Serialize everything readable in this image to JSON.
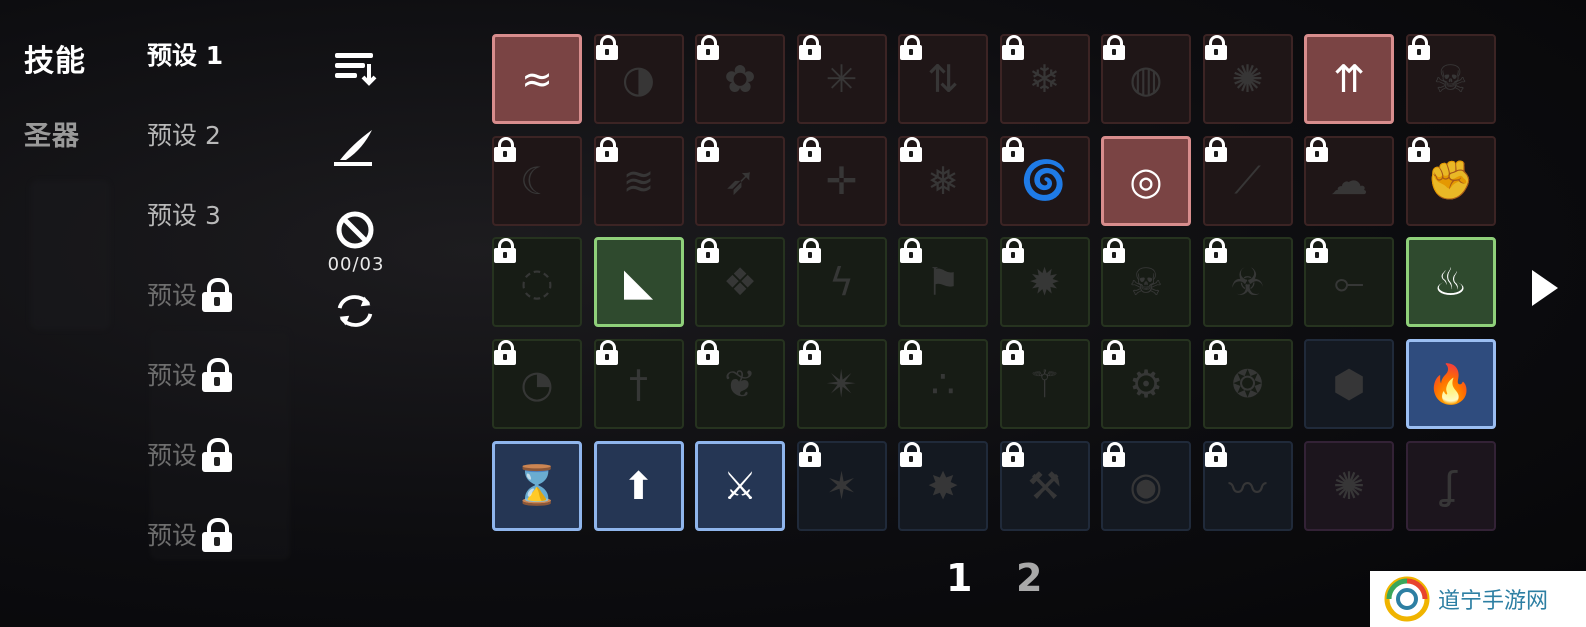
{
  "categories": {
    "skills": "技能",
    "relics": "圣器"
  },
  "presets": [
    {
      "label": "预设 1",
      "state": "active"
    },
    {
      "label": "预设 2",
      "state": "normal"
    },
    {
      "label": "预设 3",
      "state": "normal"
    },
    {
      "label": "预设",
      "state": "locked"
    },
    {
      "label": "预设",
      "state": "locked"
    },
    {
      "label": "预设",
      "state": "locked"
    },
    {
      "label": "预设",
      "state": "locked"
    }
  ],
  "tools": {
    "sort_icon": "sort-icon",
    "edit_icon": "quill-pen-icon",
    "forbid_icon": "no-entry-icon",
    "counter": "00/03",
    "reset_icon": "refresh-icon"
  },
  "grid": {
    "rows": [
      {
        "rarity": "red",
        "cells": [
          {
            "icon": "swoosh-slash-icon",
            "glyph": "≈",
            "state": "equipped",
            "locked": false
          },
          {
            "icon": "blade-circle-icon",
            "glyph": "◑",
            "state": "dim",
            "locked": true
          },
          {
            "icon": "flower-burst-icon",
            "glyph": "✿",
            "state": "dim",
            "locked": true
          },
          {
            "icon": "starburst-icon",
            "glyph": "✳",
            "state": "dim",
            "locked": true
          },
          {
            "icon": "arrows-icon",
            "glyph": "⇅",
            "state": "dim",
            "locked": true
          },
          {
            "icon": "snow-orb-icon",
            "glyph": "❄",
            "state": "dim",
            "locked": true
          },
          {
            "icon": "fire-orb-icon",
            "glyph": "◍",
            "state": "dim",
            "locked": true
          },
          {
            "icon": "dark-storm-icon",
            "glyph": "✺",
            "state": "dim",
            "locked": true
          },
          {
            "icon": "triple-arrows-icon",
            "glyph": "⇈",
            "state": "equipped",
            "locked": false
          },
          {
            "icon": "cow-skull-icon",
            "glyph": "☠",
            "state": "dim",
            "locked": true
          }
        ]
      },
      {
        "rarity": "red",
        "cells": [
          {
            "icon": "crescent-icon",
            "glyph": "☾",
            "state": "dim",
            "locked": true
          },
          {
            "icon": "feathers-icon",
            "glyph": "≋",
            "state": "dim",
            "locked": true
          },
          {
            "icon": "dart-icon",
            "glyph": "➶",
            "state": "dim",
            "locked": true
          },
          {
            "icon": "crosshair-icon",
            "glyph": "✛",
            "state": "dim",
            "locked": true
          },
          {
            "icon": "ice-sword-icon",
            "glyph": "❅",
            "state": "dim",
            "locked": true
          },
          {
            "icon": "vortex-icon",
            "glyph": "🌀",
            "state": "dim",
            "locked": true
          },
          {
            "icon": "target-orb-icon",
            "glyph": "◎",
            "state": "equipped",
            "locked": false
          },
          {
            "icon": "spiky-line-icon",
            "glyph": "⟋",
            "state": "dim",
            "locked": true
          },
          {
            "icon": "cloud-burst-icon",
            "glyph": "☁",
            "state": "dim",
            "locked": true
          },
          {
            "icon": "gauntlet-icon",
            "glyph": "✊",
            "state": "dim",
            "locked": true
          }
        ]
      },
      {
        "rarity": "green",
        "cells": [
          {
            "icon": "black-hole-icon",
            "glyph": "◌",
            "state": "dim",
            "locked": true
          },
          {
            "icon": "impact-spike-icon",
            "glyph": "◣",
            "state": "equipped",
            "locked": false
          },
          {
            "icon": "crystal-chunk-icon",
            "glyph": "❖",
            "state": "dim",
            "locked": true
          },
          {
            "icon": "lightning-icon",
            "glyph": "ϟ",
            "state": "dim",
            "locked": true
          },
          {
            "icon": "turret-icon",
            "glyph": "⚑",
            "state": "dim",
            "locked": true
          },
          {
            "icon": "swirl-fire-icon",
            "glyph": "✹",
            "state": "dim",
            "locked": true
          },
          {
            "icon": "skull-burst-icon",
            "glyph": "☠",
            "state": "dim",
            "locked": true
          },
          {
            "icon": "biohazard-icon",
            "glyph": "☣",
            "state": "dim",
            "locked": true
          },
          {
            "icon": "lance-icon",
            "glyph": "⟜",
            "state": "dim",
            "locked": true
          },
          {
            "icon": "flame-bomb-icon",
            "glyph": "♨",
            "state": "equipped",
            "locked": false
          }
        ]
      },
      {
        "rarity": "green",
        "cells": [
          {
            "icon": "claw-orb-icon",
            "glyph": "◔",
            "state": "dim",
            "locked": true
          },
          {
            "icon": "daggers-icon",
            "glyph": "†",
            "state": "dim",
            "locked": true
          },
          {
            "icon": "winged-orb-icon",
            "glyph": "❦",
            "state": "dim",
            "locked": true
          },
          {
            "icon": "spider-crack-icon",
            "glyph": "✴",
            "state": "dim",
            "locked": true
          },
          {
            "icon": "scatter-icon",
            "glyph": "∴",
            "state": "dim",
            "locked": true
          },
          {
            "icon": "talon-icon",
            "glyph": "⚚",
            "state": "dim",
            "locked": true
          },
          {
            "icon": "tri-blade-icon",
            "glyph": "⚙",
            "state": "dim",
            "locked": true
          },
          {
            "icon": "spiked-ring-icon",
            "glyph": "❂",
            "state": "dim",
            "locked": true
          },
          {
            "icon": "shield-orbs-icon",
            "glyph": "⬢",
            "state": "dim",
            "locked": false
          },
          {
            "icon": "blue-flame-icon",
            "glyph": "🔥",
            "state": "equipped2",
            "locked": false
          }
        ]
      },
      {
        "rarity": "blue",
        "cells": [
          {
            "icon": "hourglass-up-icon",
            "glyph": "⌛",
            "state": "equipped",
            "locked": false
          },
          {
            "icon": "power-up-icon",
            "glyph": "⬆",
            "state": "equipped",
            "locked": false
          },
          {
            "icon": "sword-up-icon",
            "glyph": "⚔",
            "state": "equipped",
            "locked": false
          },
          {
            "icon": "comet-icon",
            "glyph": "✶",
            "state": "dim",
            "locked": true
          },
          {
            "icon": "power-orb-icon",
            "glyph": "✸",
            "state": "dim",
            "locked": true
          },
          {
            "icon": "axe-up-icon",
            "glyph": "⚒",
            "state": "dim",
            "locked": true
          },
          {
            "icon": "spiral-icon",
            "glyph": "◉",
            "state": "dim",
            "locked": true
          },
          {
            "icon": "dragon-icon",
            "glyph": "〰",
            "state": "dim",
            "locked": true
          },
          {
            "icon": "explosion-icon",
            "glyph": "✺",
            "state": "dim",
            "locked": false
          },
          {
            "icon": "ghost-icon",
            "glyph": "ʆ",
            "state": "dim",
            "locked": false
          }
        ]
      }
    ]
  },
  "pagination": {
    "pages": [
      "1",
      "2"
    ],
    "current": "1"
  },
  "watermark": {
    "text": "道宁手游网"
  }
}
